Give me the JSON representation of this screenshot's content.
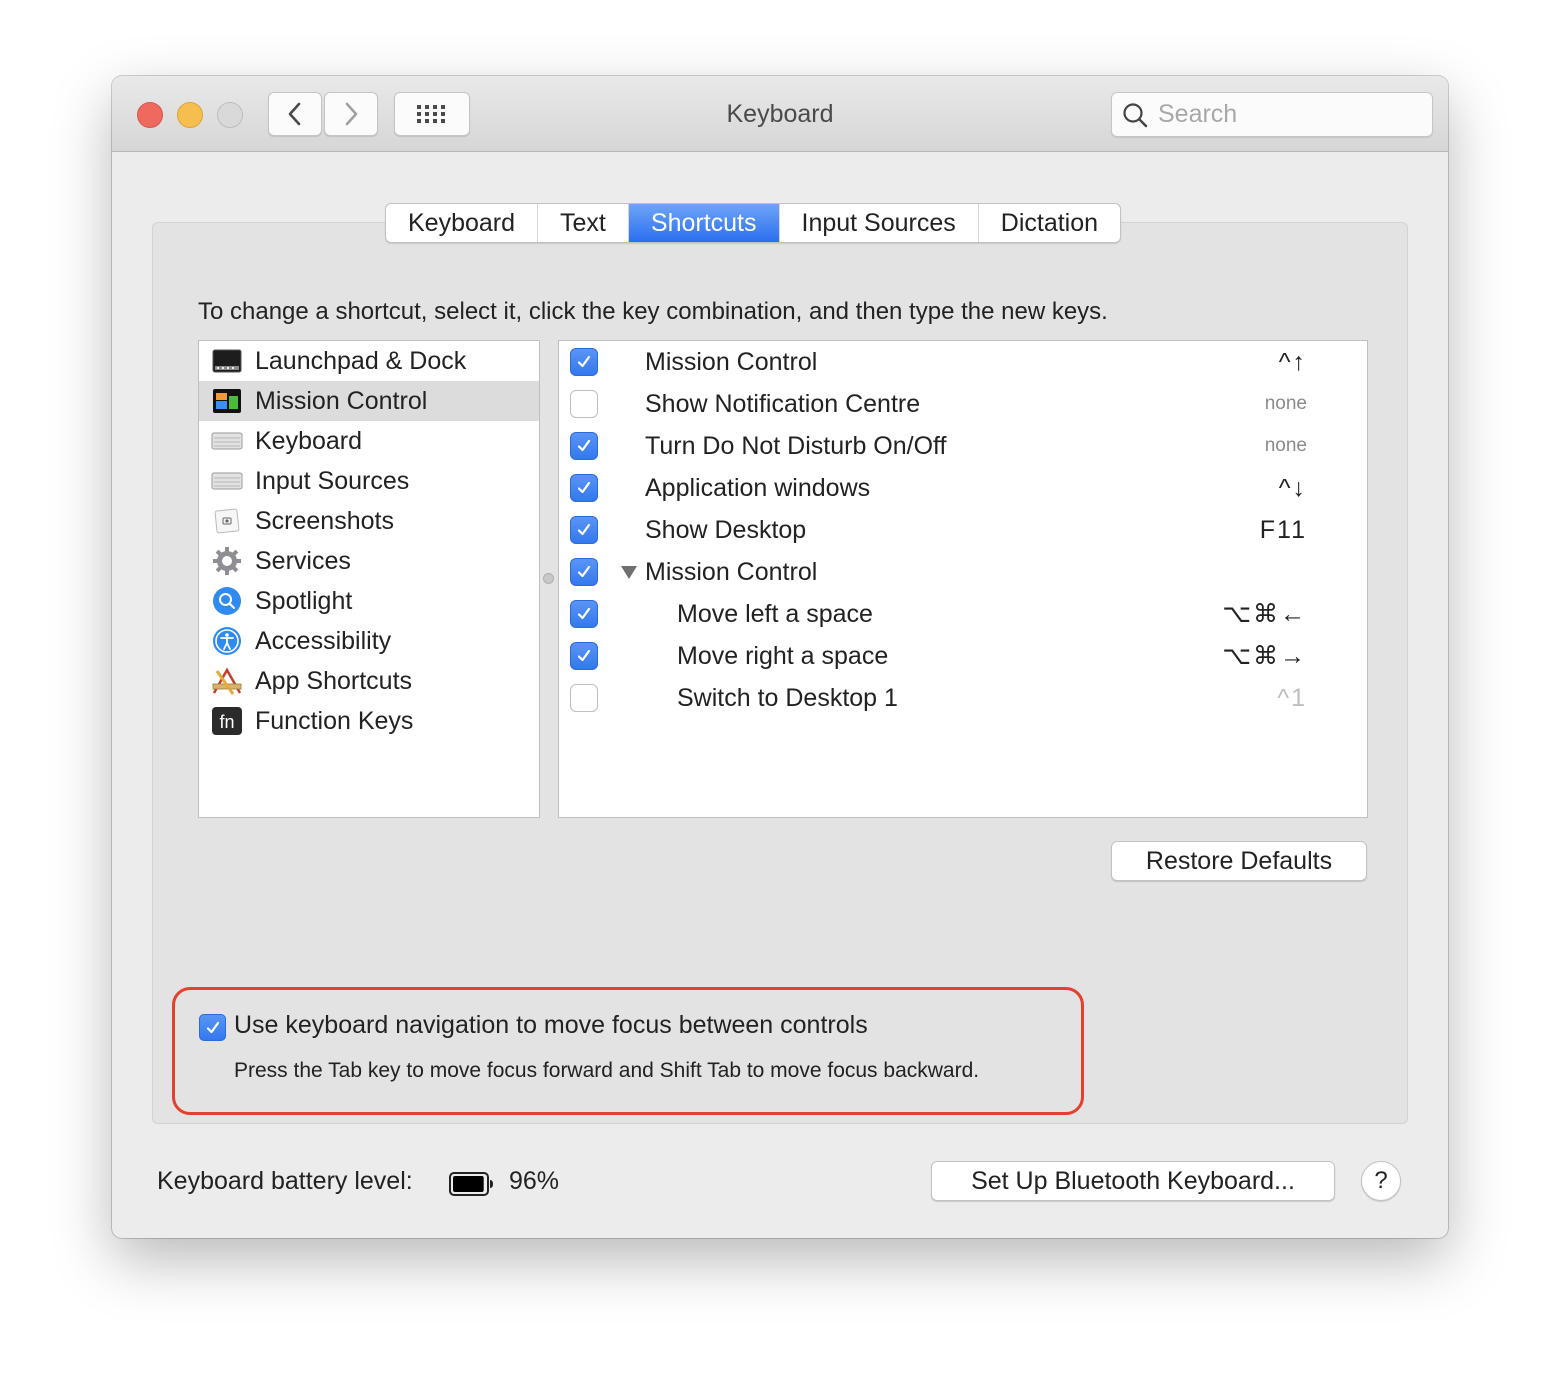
{
  "window": {
    "title": "Keyboard",
    "search_placeholder": "Search"
  },
  "toolbar": {
    "traffic_lights": [
      "close",
      "minimize",
      "zoom-disabled"
    ],
    "back_icon": "chevron-left-icon",
    "forward_icon": "chevron-right-icon",
    "grid_icon": "show-all-grid-icon"
  },
  "tabs": [
    {
      "label": "Keyboard",
      "active": false
    },
    {
      "label": "Text",
      "active": false
    },
    {
      "label": "Shortcuts",
      "active": true
    },
    {
      "label": "Input Sources",
      "active": false
    },
    {
      "label": "Dictation",
      "active": false
    }
  ],
  "instructions": "To change a shortcut, select it, click the key combination, and then type the new keys.",
  "categories": [
    {
      "label": "Launchpad & Dock",
      "icon": "launchpad-dock-icon",
      "selected": false
    },
    {
      "label": "Mission Control",
      "icon": "mission-control-icon",
      "selected": true
    },
    {
      "label": "Keyboard",
      "icon": "keyboard-icon",
      "selected": false
    },
    {
      "label": "Input Sources",
      "icon": "input-sources-icon",
      "selected": false
    },
    {
      "label": "Screenshots",
      "icon": "screenshots-icon",
      "selected": false
    },
    {
      "label": "Services",
      "icon": "services-gear-icon",
      "selected": false
    },
    {
      "label": "Spotlight",
      "icon": "spotlight-icon",
      "selected": false
    },
    {
      "label": "Accessibility",
      "icon": "accessibility-icon",
      "selected": false
    },
    {
      "label": "App Shortcuts",
      "icon": "app-shortcuts-icon",
      "selected": false
    },
    {
      "label": "Function Keys",
      "icon": "function-keys-icon",
      "selected": false
    }
  ],
  "shortcuts": [
    {
      "label": "Mission Control",
      "checked": true,
      "keys": "^↑",
      "indent": false,
      "disclosure": false,
      "key_style": "normal"
    },
    {
      "label": "Show Notification Centre",
      "checked": false,
      "keys": "none",
      "indent": false,
      "disclosure": false,
      "key_style": "none"
    },
    {
      "label": "Turn Do Not Disturb On/Off",
      "checked": true,
      "keys": "none",
      "indent": false,
      "disclosure": false,
      "key_style": "none"
    },
    {
      "label": "Application windows",
      "checked": true,
      "keys": "^↓",
      "indent": false,
      "disclosure": false,
      "key_style": "normal"
    },
    {
      "label": "Show Desktop",
      "checked": true,
      "keys": "F11",
      "indent": false,
      "disclosure": false,
      "key_style": "normal"
    },
    {
      "label": "Mission Control",
      "checked": true,
      "keys": "",
      "indent": false,
      "disclosure": true,
      "key_style": "normal"
    },
    {
      "label": "Move left a space",
      "checked": true,
      "keys": "⌥⌘←",
      "indent": true,
      "disclosure": false,
      "key_style": "normal"
    },
    {
      "label": "Move right a space",
      "checked": true,
      "keys": "⌥⌘→",
      "indent": true,
      "disclosure": false,
      "key_style": "normal"
    },
    {
      "label": "Switch to Desktop 1",
      "checked": false,
      "keys": "^1",
      "indent": true,
      "disclosure": false,
      "key_style": "dim"
    }
  ],
  "restore_defaults_label": "Restore Defaults",
  "keyboard_navigation": {
    "checked": true,
    "label": "Use keyboard navigation to move focus between controls",
    "help": "Press the Tab key to move focus forward and Shift Tab to move focus backward.",
    "highlight_color": "#e3412d"
  },
  "battery": {
    "label": "Keyboard battery level:",
    "percent_text": "96%",
    "level": 0.96
  },
  "bluetooth_button_label": "Set Up Bluetooth Keyboard...",
  "help_button_label": "?",
  "colors": {
    "accent": "#3478ee",
    "window_bg": "#ececec"
  }
}
